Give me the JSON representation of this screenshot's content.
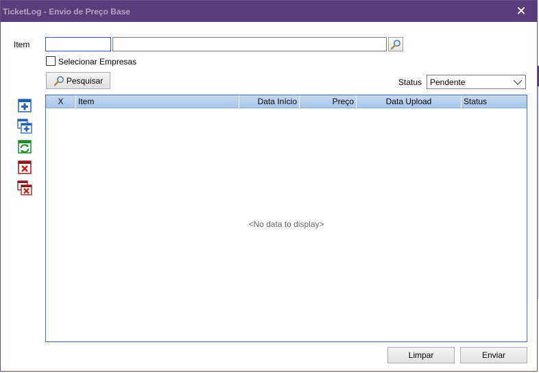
{
  "window": {
    "title": "TicketLog - Envio de Preço Base",
    "close_glyph": "✕"
  },
  "form": {
    "item_label": "Item",
    "item_code_value": "",
    "item_description_value": "",
    "select_companies_label": "Selecionar Empresas",
    "search_button_label": "Pesquisar",
    "status_label": "Status",
    "status_value": "Pendente"
  },
  "side_toolbar": [
    {
      "icon": "add-icon",
      "color": "#1f63b8"
    },
    {
      "icon": "add-multiple-icon",
      "color": "#1f63b8"
    },
    {
      "icon": "refresh-icon",
      "color": "#1d8a2e"
    },
    {
      "icon": "delete-icon",
      "color": "#c01818"
    },
    {
      "icon": "delete-multiple-icon",
      "color": "#c01818"
    }
  ],
  "grid": {
    "columns": [
      "X",
      "Item",
      "Data Início",
      "Preço",
      "Data Upload",
      "Status"
    ],
    "empty_text": "<No data to display>"
  },
  "footer": {
    "clear_button_label": "Limpar",
    "send_button_label": "Enviar"
  },
  "colors": {
    "titlebar": "#5a3d7a",
    "grid_header": "#b9d0ee",
    "grid_border": "#3b6fb5"
  }
}
